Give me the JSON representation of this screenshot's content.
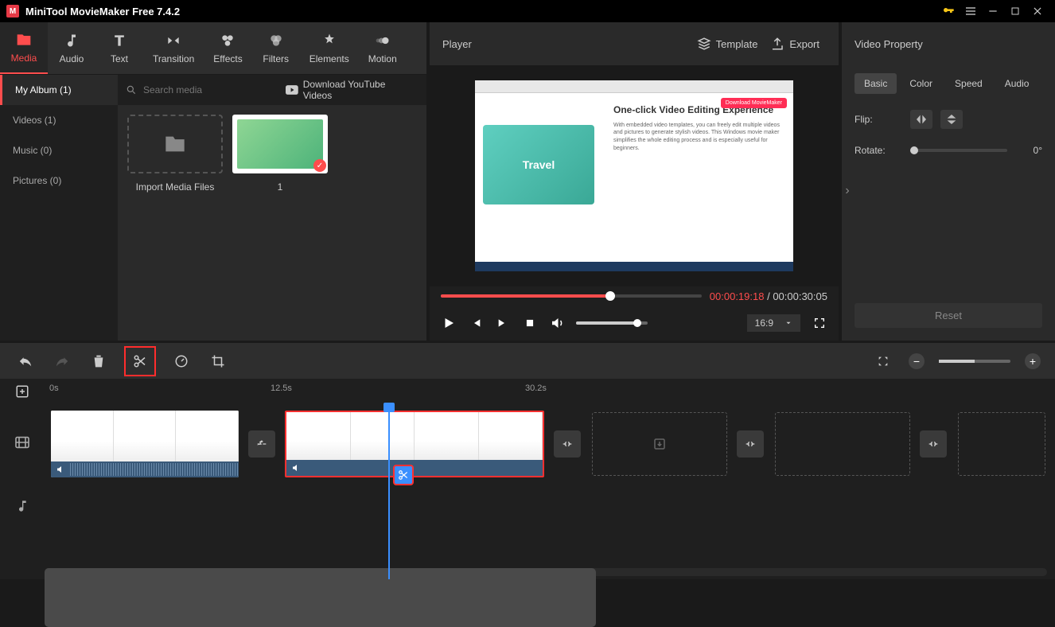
{
  "app": {
    "title": "MiniTool MovieMaker Free 7.4.2"
  },
  "toptabs": [
    {
      "label": "Media"
    },
    {
      "label": "Audio"
    },
    {
      "label": "Text"
    },
    {
      "label": "Transition"
    },
    {
      "label": "Effects"
    },
    {
      "label": "Filters"
    },
    {
      "label": "Elements"
    },
    {
      "label": "Motion"
    }
  ],
  "sidetabs": [
    {
      "label": "My Album (1)"
    },
    {
      "label": "Videos (1)"
    },
    {
      "label": "Music (0)"
    },
    {
      "label": "Pictures (0)"
    }
  ],
  "search": {
    "placeholder": "Search media"
  },
  "download_yt": "Download YouTube Videos",
  "import_label": "Import Media Files",
  "thumb_label": "1",
  "player": {
    "title": "Player",
    "template": "Template",
    "export": "Export",
    "headline": "One-click Video Editing Experience",
    "desc": "With embedded video templates, you can freely edit multiple videos and pictures to generate stylish videos. This Windows movie maker simplifies the whole editing process and is especially useful for beginners.",
    "dlbtn": "Download MovieMaker",
    "cur_time": "00:00:19:18",
    "sep": " / ",
    "total_time": "00:00:30:05",
    "aspect": "16:9"
  },
  "props": {
    "title": "Video Property",
    "tabs": [
      {
        "label": "Basic"
      },
      {
        "label": "Color"
      },
      {
        "label": "Speed"
      },
      {
        "label": "Audio"
      }
    ],
    "flip": "Flip:",
    "rotate": "Rotate:",
    "rotate_val": "0°",
    "reset": "Reset"
  },
  "ruler": {
    "t0": "0s",
    "t1": "12.5s",
    "t2": "30.2s"
  }
}
